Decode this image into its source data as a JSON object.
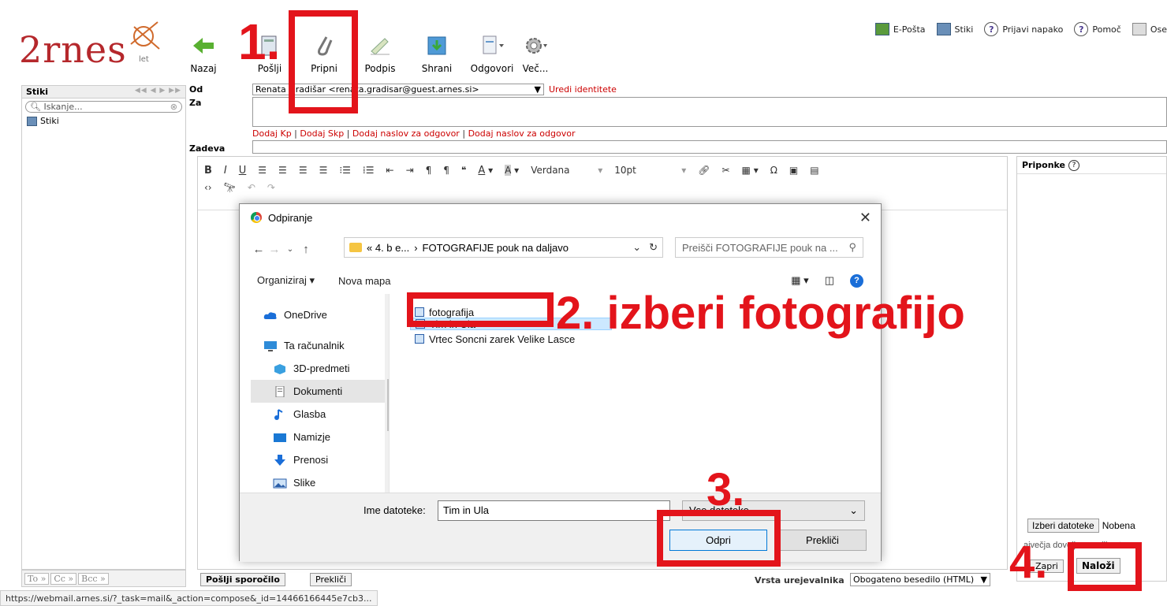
{
  "app": {
    "logo_text": "2rnes",
    "logo_let": "let"
  },
  "colors": {
    "accent": "#b5282c",
    "annotation": "#e3141b",
    "link": "#cc0000"
  },
  "topnav": {
    "email": "E-Pošta",
    "contacts": "Stiki",
    "report_bug": "Prijavi napako",
    "help": "Pomoč",
    "personal": "Ose"
  },
  "toolbar": {
    "back": "Nazaj",
    "send": "Pošlji",
    "attach": "Pripni",
    "signature": "Podpis",
    "save": "Shrani",
    "reply": "Odgovori",
    "more": "Več..."
  },
  "sidebar": {
    "title": "Stiki",
    "pager": "◀◀ ◀ ▶ ▶▶",
    "search_placeholder": "Iskanje...",
    "item": "Stiki",
    "to": "To »",
    "cc": "Cc »",
    "bcc": "Bcc »"
  },
  "compose": {
    "from_label": "Od",
    "to_label": "Za",
    "subject_label": "Zadeva",
    "from_value": "Renata Gradišar <renata.gradisar@guest.arnes.si>",
    "edit_identities": "Uredi identitete",
    "add_cc": "Dodaj Kp",
    "add_bcc": "Dodaj Skp",
    "add_reply_to": "Dodaj naslov za odgovor",
    "add_followup_to": "Dodaj naslov za odgovor"
  },
  "editor": {
    "font": "Verdana",
    "size": "10pt",
    "send_button": "Pošlji sporočilo",
    "cancel_button": "Prekliči",
    "type_label": "Vrsta urejevalnika",
    "type_value": "Obogateno besedilo (HTML)"
  },
  "attachments": {
    "title": "Priponke",
    "choose_file": "Izberi datoteke",
    "no_file": "Nobena",
    "max_size": "ajvečja dovoljena velikost",
    "close": "Zapri",
    "upload": "Naloži"
  },
  "dialog": {
    "title": "Odpiranje",
    "path_prefix": "«  4. b e...",
    "path_sep": "›",
    "path_folder": "FOTOGRAFIJE pouk na daljavo",
    "search_placeholder": "Preišči FOTOGRAFIJE pouk na ...",
    "organize": "Organiziraj",
    "new_folder": "Nova mapa",
    "tree": [
      "OneDrive",
      "Ta računalnik",
      "3D-predmeti",
      "Dokumenti",
      "Glasba",
      "Namizje",
      "Prenosi",
      "Slike"
    ],
    "files": [
      "fotografija",
      "Tim in Ula",
      "Vrtec Soncni zarek Velike Lasce"
    ],
    "filename_label": "Ime datoteke:",
    "filename_value": "Tim in Ula",
    "filetype_value": "Vse datoteke",
    "open_button": "Odpri",
    "cancel_button": "Prekliči"
  },
  "annotations": {
    "step1": "1.",
    "step2": "2. izberi fotografijo",
    "step3": "3.",
    "step4": "4."
  },
  "status_url": "https://webmail.arnes.si/?_task=mail&_action=compose&_id=14466166445e7cb3..."
}
